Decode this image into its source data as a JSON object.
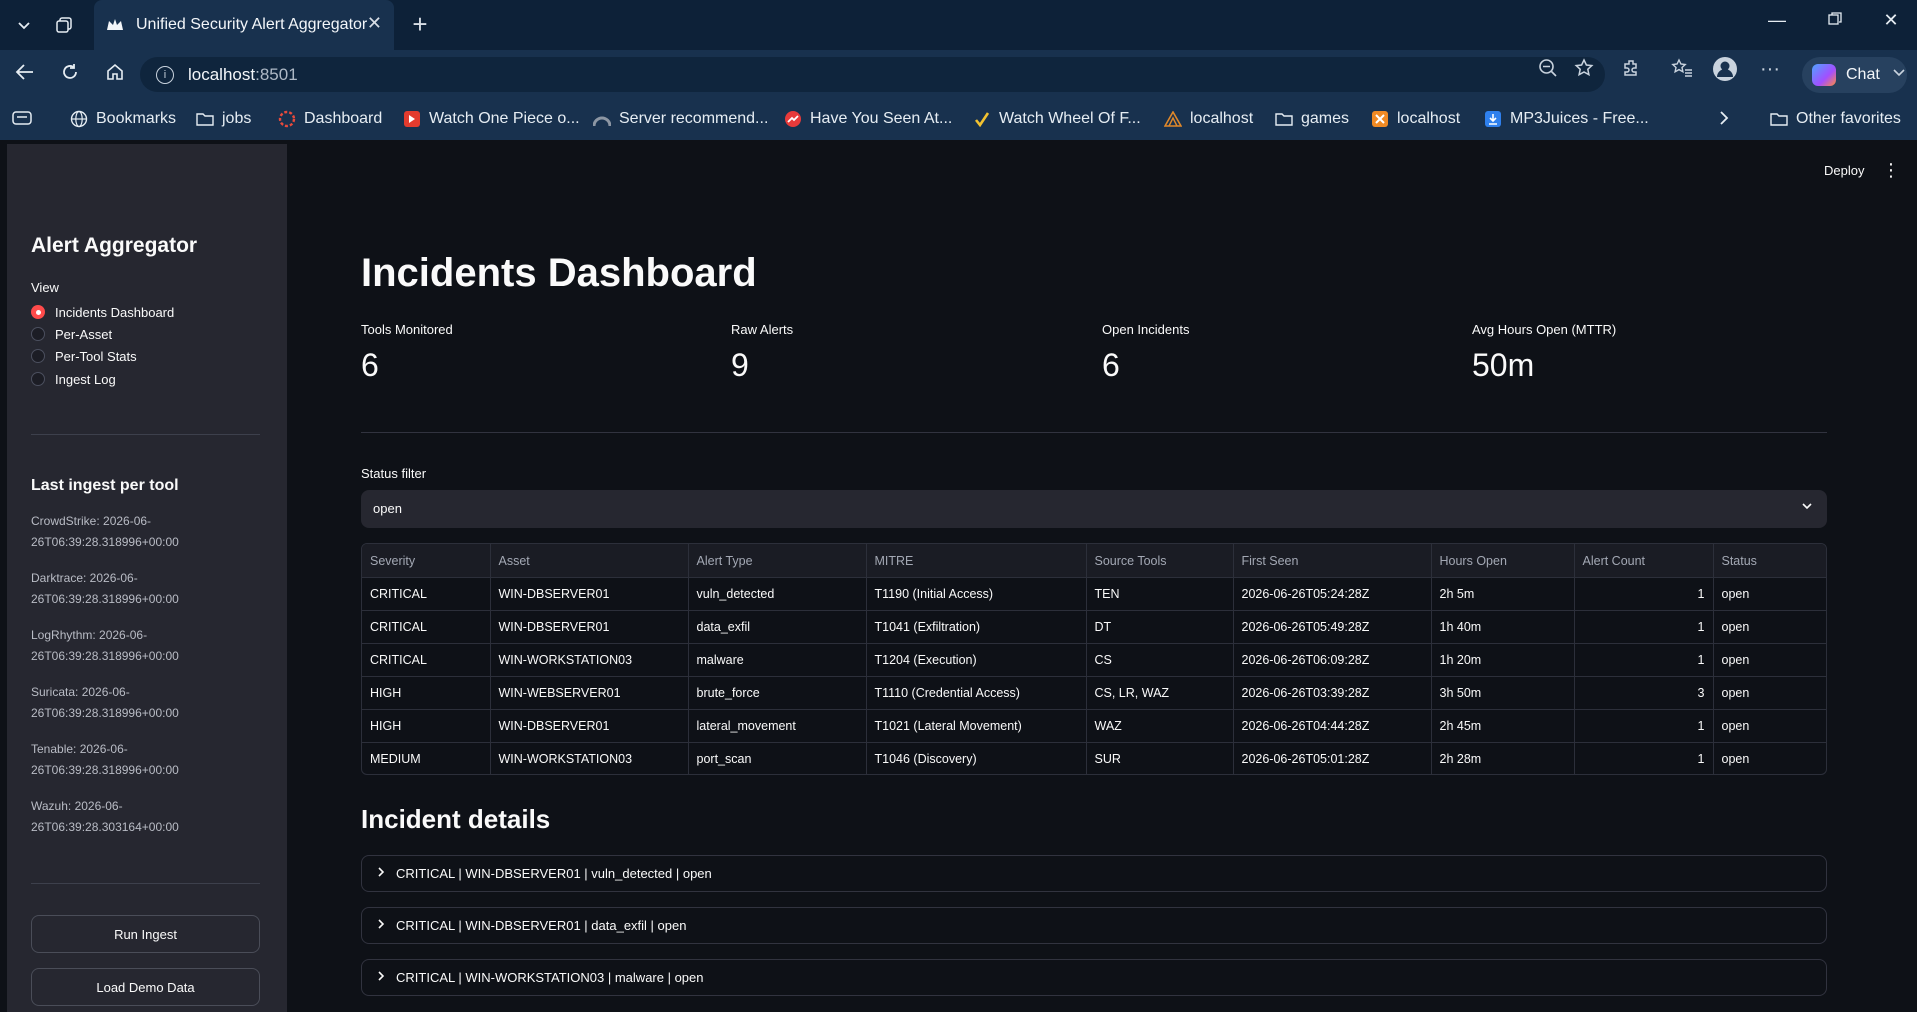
{
  "browser": {
    "tab_title": "Unified Security Alert Aggregator",
    "url_host": "localhost",
    "url_port": ":8501",
    "chat_label": "Chat",
    "bookmarks": [
      {
        "label": "Bookmarks",
        "icon": "globe-icon"
      },
      {
        "label": "jobs",
        "icon": "folder-icon"
      },
      {
        "label": "Dashboard",
        "icon": "dashboard-icon"
      },
      {
        "label": "Watch One Piece o...",
        "icon": "site-icon"
      },
      {
        "label": "Server recommend...",
        "icon": "site-icon"
      },
      {
        "label": "Have You Seen At...",
        "icon": "site-icon"
      },
      {
        "label": "Watch Wheel Of F...",
        "icon": "site-icon"
      },
      {
        "label": "localhost",
        "icon": "site-icon"
      },
      {
        "label": "games",
        "icon": "folder-icon"
      },
      {
        "label": "localhost",
        "icon": "site-icon"
      },
      {
        "label": "MP3Juices - Free...",
        "icon": "site-icon"
      }
    ],
    "other_favorites": "Other favorites"
  },
  "sidebar": {
    "title": "Alert Aggregator",
    "view_label": "View",
    "views": [
      "Incidents Dashboard",
      "Per-Asset",
      "Per-Tool Stats",
      "Ingest Log"
    ],
    "selected_view": "Incidents Dashboard",
    "ingest_title": "Last ingest per tool",
    "ingest": [
      {
        "line1": "CrowdStrike: 2026-06-",
        "line2": "26T06:39:28.318996+00:00"
      },
      {
        "line1": "Darktrace: 2026-06-",
        "line2": "26T06:39:28.318996+00:00"
      },
      {
        "line1": "LogRhythm: 2026-06-",
        "line2": "26T06:39:28.318996+00:00"
      },
      {
        "line1": "Suricata: 2026-06-",
        "line2": "26T06:39:28.318996+00:00"
      },
      {
        "line1": "Tenable: 2026-06-",
        "line2": "26T06:39:28.318996+00:00"
      },
      {
        "line1": "Wazuh: 2026-06-",
        "line2": "26T06:39:28.303164+00:00"
      }
    ],
    "run_ingest": "Run Ingest",
    "load_demo": "Load Demo Data"
  },
  "main": {
    "deploy": "Deploy",
    "title": "Incidents Dashboard",
    "metrics": [
      {
        "label": "Tools Monitored",
        "value": "6"
      },
      {
        "label": "Raw Alerts",
        "value": "9"
      },
      {
        "label": "Open Incidents",
        "value": "6"
      },
      {
        "label": "Avg Hours Open (MTTR)",
        "value": "50m"
      }
    ],
    "filter_label": "Status filter",
    "filter_value": "open",
    "table": {
      "columns": [
        "Severity",
        "Asset",
        "Alert Type",
        "MITRE",
        "Source Tools",
        "First Seen",
        "Hours Open",
        "Alert Count",
        "Status"
      ],
      "rows": [
        [
          "CRITICAL",
          "WIN-DBSERVER01",
          "vuln_detected",
          "T1190 (Initial Access)",
          "TEN",
          "2026-06-26T05:24:28Z",
          "2h 5m",
          "1",
          "open"
        ],
        [
          "CRITICAL",
          "WIN-DBSERVER01",
          "data_exfil",
          "T1041 (Exfiltration)",
          "DT",
          "2026-06-26T05:49:28Z",
          "1h 40m",
          "1",
          "open"
        ],
        [
          "CRITICAL",
          "WIN-WORKSTATION03",
          "malware",
          "T1204 (Execution)",
          "CS",
          "2026-06-26T06:09:28Z",
          "1h 20m",
          "1",
          "open"
        ],
        [
          "HIGH",
          "WIN-WEBSERVER01",
          "brute_force",
          "T1110 (Credential Access)",
          "CS, LR, WAZ",
          "2026-06-26T03:39:28Z",
          "3h 50m",
          "3",
          "open"
        ],
        [
          "HIGH",
          "WIN-DBSERVER01",
          "lateral_movement",
          "T1021 (Lateral Movement)",
          "WAZ",
          "2026-06-26T04:44:28Z",
          "2h 45m",
          "1",
          "open"
        ],
        [
          "MEDIUM",
          "WIN-WORKSTATION03",
          "port_scan",
          "T1046 (Discovery)",
          "SUR",
          "2026-06-26T05:01:28Z",
          "2h 28m",
          "1",
          "open"
        ]
      ]
    },
    "details_title": "Incident details",
    "details": [
      "CRITICAL | WIN-DBSERVER01 | vuln_detected | open",
      "CRITICAL | WIN-DBSERVER01 | data_exfil | open",
      "CRITICAL | WIN-WORKSTATION03 | malware | open"
    ]
  },
  "colors": {
    "accent": "#ff4b4b",
    "background": "#0e1117",
    "sidebar": "#262730",
    "browser_chrome": "#18314e"
  }
}
